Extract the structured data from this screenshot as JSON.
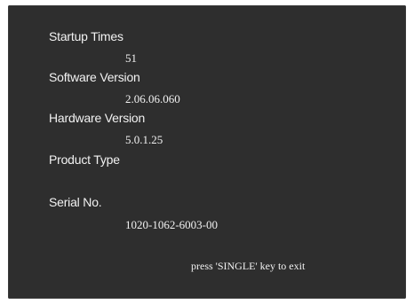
{
  "info": {
    "startup_times_label": "Startup Times",
    "startup_times_value": "51",
    "software_version_label": "Software Version",
    "software_version_value": "2.06.06.060",
    "hardware_version_label": "Hardware Version",
    "hardware_version_value": "5.0.1.25",
    "product_type_label": "Product Type",
    "product_type_value": "",
    "serial_no_label": "Serial No.",
    "serial_no_value": "1020-1062-6003-00"
  },
  "footer": {
    "exit_hint": "press 'SINGLE' key to exit"
  },
  "colors": {
    "screen_background": "#2e2e2e",
    "text": "#f2f2f2"
  }
}
